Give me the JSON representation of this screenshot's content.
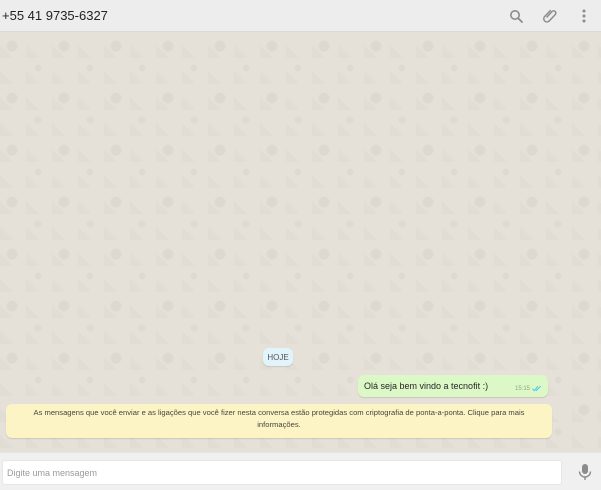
{
  "header": {
    "contact": "+55 41 9735-6327",
    "icons": [
      "search-icon",
      "attach-icon",
      "menu-icon"
    ]
  },
  "chat": {
    "date_label": "HOJE",
    "message": {
      "text": "Olá seja bem vindo a tecnofit :)",
      "time": "15:15",
      "status_icon": "double-check-icon"
    },
    "encryption_notice": "As mensagens que você enviar e as ligações que você fizer nesta conversa estão protegidas com criptografia de ponta-a-ponta. Clique para mais informações."
  },
  "composer": {
    "placeholder": "Digite uma mensagem",
    "value": "",
    "mic_icon": "microphone-icon"
  },
  "colors": {
    "header_bg": "#ededed",
    "chat_bg": "#e6e1d8",
    "outgoing_bubble": "#dcf8c6",
    "date_pill": "#e1f3fb",
    "notice_bg": "#fdf4c5",
    "read_tick": "#4fc3f7"
  }
}
